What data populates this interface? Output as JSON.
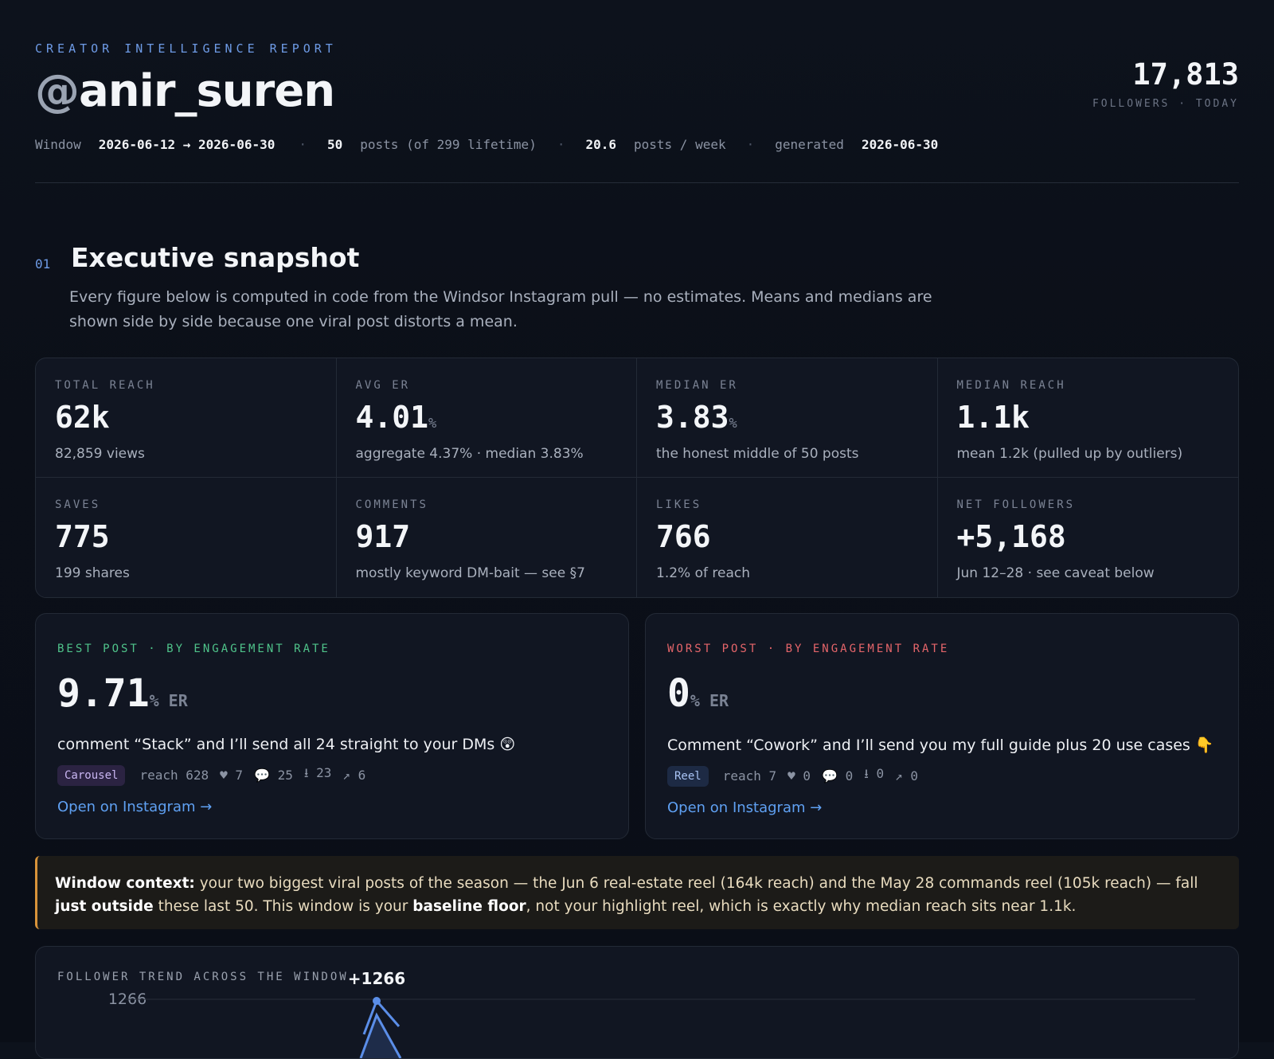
{
  "header": {
    "eyebrow": "CREATOR INTELLIGENCE REPORT",
    "handle_at": "@",
    "handle_name": "anir_suren",
    "followers_value": "17,813",
    "followers_caption": "FOLLOWERS · TODAY",
    "meta": {
      "window_label": "Window",
      "window_range": "2026-06-12 → 2026-06-30",
      "posts_count": "50",
      "posts_label": "posts (of 299 lifetime)",
      "per_week": "20.6",
      "per_week_label": "posts / week",
      "generated_label": "generated",
      "generated_date": "2026-06-30"
    }
  },
  "section": {
    "number": "01",
    "title": "Executive snapshot",
    "description": "Every figure below is computed in code from the Windsor Instagram pull — no estimates. Means and medians are shown side by side because one viral post distorts a mean."
  },
  "kpis": [
    {
      "label": "TOTAL REACH",
      "value": "62k",
      "unit": "",
      "sub": "82,859 views"
    },
    {
      "label": "AVG ER",
      "value": "4.01",
      "unit": "%",
      "sub": "aggregate 4.37% · median 3.83%"
    },
    {
      "label": "MEDIAN ER",
      "value": "3.83",
      "unit": "%",
      "sub": "the honest middle of 50 posts"
    },
    {
      "label": "MEDIAN REACH",
      "value": "1.1k",
      "unit": "",
      "sub": "mean 1.2k (pulled up by outliers)"
    },
    {
      "label": "SAVES",
      "value": "775",
      "unit": "",
      "sub": "199 shares"
    },
    {
      "label": "COMMENTS",
      "value": "917",
      "unit": "",
      "sub": "mostly keyword DM-bait — see §7"
    },
    {
      "label": "LIKES",
      "value": "766",
      "unit": "",
      "sub": "1.2% of reach"
    },
    {
      "label": "NET FOLLOWERS",
      "value": "+5,168",
      "unit": "",
      "sub": "Jun 12–28 · see caveat below"
    }
  ],
  "best_post": {
    "tag": "BEST POST · BY ENGAGEMENT RATE",
    "er": "9.71",
    "er_unit": "% ER",
    "caption": "comment “Stack” and I’ll send all 24 straight to your DMs 😲",
    "type": "Carousel",
    "reach": "reach 628",
    "likes": "♥ 7",
    "comments": "💬 25",
    "saves": "⭳ 23",
    "shares": "↗ 6",
    "link": "Open on Instagram →"
  },
  "worst_post": {
    "tag": "WORST POST · BY ENGAGEMENT RATE",
    "er": "0",
    "er_unit": "% ER",
    "caption": "Comment “Cowork” and I’ll send you my full guide plus 20 use cases 👇",
    "type": "Reel",
    "reach": "reach 7",
    "likes": "♥ 0",
    "comments": "💬 0",
    "saves": "⭳ 0",
    "shares": "↗ 0",
    "link": "Open on Instagram →"
  },
  "callout": {
    "lead": "Window context:",
    "t1": " your two biggest viral posts of the season — the Jun 6 real-estate reel (164k reach) and the May 28 commands reel (105k reach) — fall ",
    "b1": "just outside",
    "t2": " these last 50. This window is your ",
    "b2": "baseline floor",
    "t3": ", not your highlight reel, which is exactly why median reach sits near 1.1k."
  },
  "trend": {
    "title": "FOLLOWER TREND ACROSS THE WINDOW",
    "peak_label": "+1266",
    "y_tick": "1266"
  },
  "colors": {
    "accent_blue": "#6e9be6",
    "best_green": "#4fc38a",
    "worst_red": "#e5656a",
    "callout_border": "#d9933a",
    "link": "#5fa0f2"
  }
}
